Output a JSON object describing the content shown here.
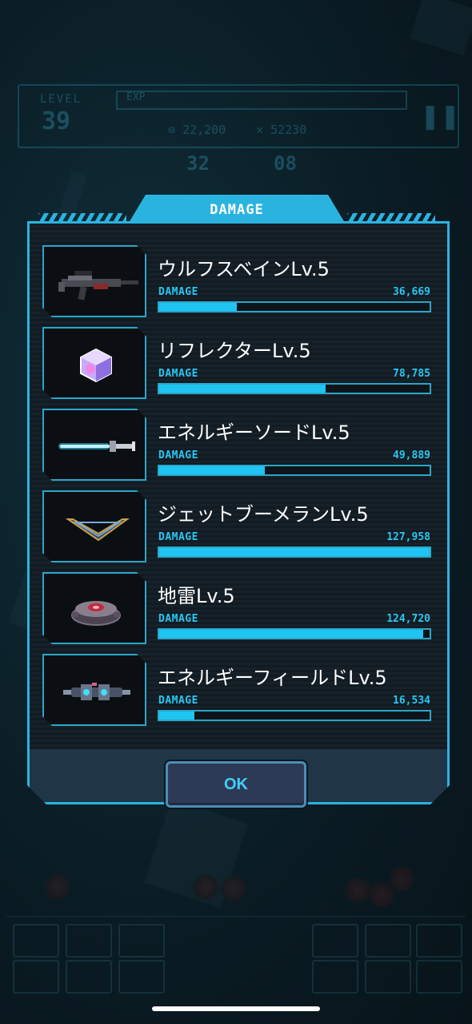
{
  "hud": {
    "level_label": "LEVEL",
    "level_value": "39",
    "exp_label": "EXP",
    "coins": "22,200",
    "kills": "52230",
    "time_minutes": "32",
    "time_seconds": "08",
    "pause_icon": "pause-icon"
  },
  "modal": {
    "title": "DAMAGE",
    "ok_label": "OK"
  },
  "weapons": [
    {
      "name": "ウルフスベインLv.5",
      "damage_label": "DAMAGE",
      "damage": "36,669",
      "fill": 0.287,
      "icon": "rifle-icon"
    },
    {
      "name": "リフレクターLv.5",
      "damage_label": "DAMAGE",
      "damage": "78,785",
      "fill": 0.615,
      "icon": "crystal-cube-icon"
    },
    {
      "name": "エネルギーソードLv.5",
      "damage_label": "DAMAGE",
      "damage": "49,889",
      "fill": 0.39,
      "icon": "energy-sword-icon"
    },
    {
      "name": "ジェットブーメランLv.5",
      "damage_label": "DAMAGE",
      "damage": "127,958",
      "fill": 1.0,
      "icon": "boomerang-icon"
    },
    {
      "name": "地雷Lv.5",
      "damage_label": "DAMAGE",
      "damage": "124,720",
      "fill": 0.975,
      "icon": "landmine-icon"
    },
    {
      "name": "エネルギーフィールドLv.5",
      "damage_label": "DAMAGE",
      "damage": "16,534",
      "fill": 0.13,
      "icon": "field-generator-icon"
    }
  ],
  "colors": {
    "accent": "#2bb3e0",
    "bar_fill": "#1fc4f2",
    "panel": "#121b22"
  }
}
